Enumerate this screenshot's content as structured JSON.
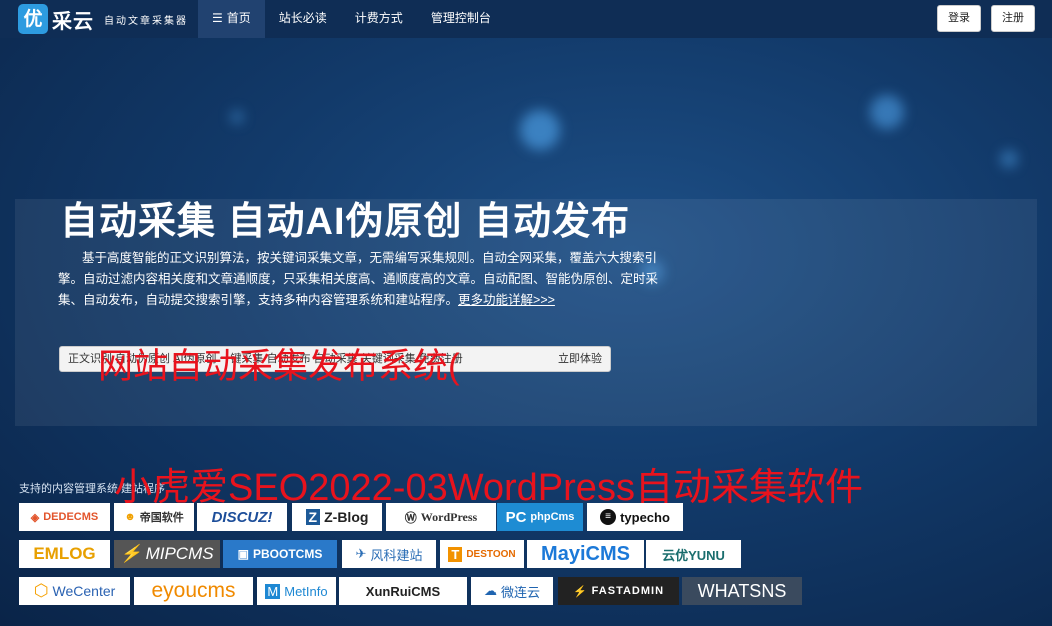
{
  "brand": {
    "badge": "优",
    "name": "采云",
    "tagline": "自动文章采集器"
  },
  "nav": {
    "items": [
      {
        "label": "首页",
        "active": true,
        "icon": "menu-icon"
      },
      {
        "label": "站长必读"
      },
      {
        "label": "计费方式"
      },
      {
        "label": "管理控制台"
      }
    ],
    "login_label": "登录",
    "register_label": "注册"
  },
  "hero": {
    "title": "自动采集 自动AI伪原创 自动发布",
    "description": "基于高度智能的正文识别算法，按关键词采集文章，无需编写采集规则。自动全网采集，覆盖六大搜索引擎。自动过滤内容相关度和文章通顺度，只采集相关度高、通顺度高的文章。自动配图、智能伪原创、定时采集、自动发布，自动提交搜索引擎，支持多种内容管理系统和建站程序。",
    "more_link": "更多功能详解>>>",
    "cta_left": "正文识别 自动伪原创 AI伪原创 一键采集 自动发布 自动采集 关键词采集 免费注册",
    "cta_right": "立即体验"
  },
  "overlay": {
    "line1": "网站自动采集发布系统(",
    "line2": "小虎爱SEO2022-03WordPress自动采集软件"
  },
  "cms": {
    "heading": "支持的内容管理系统/建站程序",
    "logos": [
      [
        "DEDECMS",
        "帝国软件",
        "DISCUZ!",
        "Z-Blog",
        "WordPress",
        "phpCms",
        "typecho"
      ],
      [
        "EMLOG",
        "MIPCMS",
        "PBOOTCMS",
        "风科建站",
        "DESTOON",
        "MayiCMS",
        "云优YUNU"
      ],
      [
        "WeCenter",
        "eyoucms",
        "MetInfo",
        "XunRuiCMS",
        "微连云",
        "FASTADMIN",
        "WHATSNS"
      ]
    ]
  },
  "colors": {
    "overlay_text": "#e8131d",
    "nav_bg": "#0f2d55",
    "active_nav_bg": "#214270",
    "brand_badge": "#2d9be0"
  }
}
